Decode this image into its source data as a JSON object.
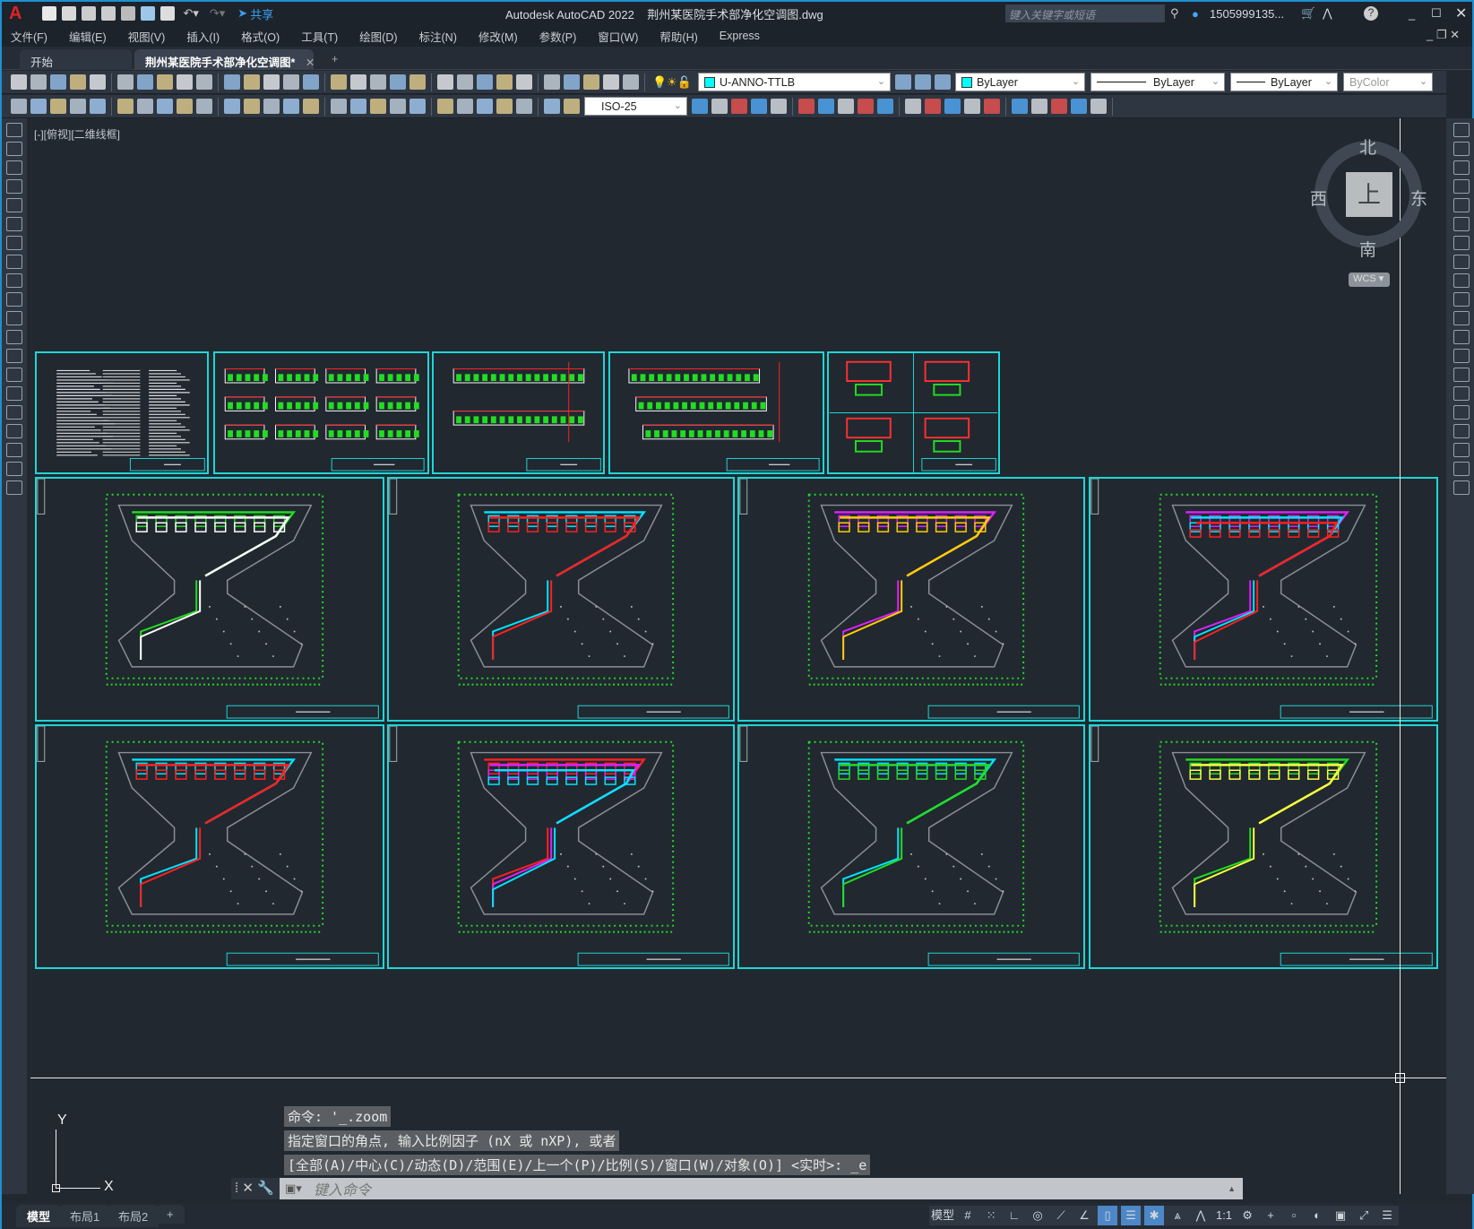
{
  "app": {
    "title": "Autodesk AutoCAD 2022",
    "file": "荆州某医院手术部净化空调图.dwg",
    "share": "共享",
    "search_placeholder": "键入关键字或短语",
    "user": "1505999135...",
    "window_controls": [
      "minimize",
      "maximize",
      "close"
    ]
  },
  "menu": [
    "文件(F)",
    "编辑(E)",
    "视图(V)",
    "插入(I)",
    "格式(O)",
    "工具(T)",
    "绘图(D)",
    "标注(N)",
    "修改(M)",
    "参数(P)",
    "窗口(W)",
    "帮助(H)",
    "Express"
  ],
  "tabs": [
    {
      "label": "开始",
      "active": false
    },
    {
      "label": "荆州某医院手术部净化空调图*",
      "active": true
    }
  ],
  "properties": {
    "layer": "U-ANNO-TTLB",
    "layer_color": "#00ffff",
    "color": "ByLayer",
    "linetype": "ByLayer",
    "lineweight": "ByLayer",
    "plotstyle": "ByColor",
    "dimstyle": "ISO-25"
  },
  "viewport": {
    "label": "[-][俯视][二维线框]"
  },
  "viewcube": {
    "north": "北",
    "south": "南",
    "east": "东",
    "west": "西",
    "face": "上",
    "ucs": "WCS"
  },
  "ucs": {
    "x": "X",
    "y": "Y"
  },
  "command": {
    "history": [
      "命令: '_.zoom",
      "指定窗口的角点, 输入比例因子 (nX 或 nXP), 或者",
      "[全部(A)/中心(C)/动态(D)/范围(E)/上一个(P)/比例(S)/窗口(W)/对象(O)] <实时>: _e"
    ],
    "placeholder": "键入命令"
  },
  "layouts": [
    {
      "label": "模型",
      "active": true
    },
    {
      "label": "布局1",
      "active": false
    },
    {
      "label": "布局2",
      "active": false
    }
  ],
  "status": {
    "model": "模型",
    "scale": "1:1"
  },
  "colors": {
    "frame": "#1ed6d6",
    "grid": "#22dd22",
    "wall": "#8a8f95",
    "duct_cyan": "#00e5ff",
    "duct_red": "#ff2020",
    "duct_magenta": "#e020ff"
  },
  "plans": [
    [
      "#22dd22",
      "#ffffff"
    ],
    [
      "#00e5ff",
      "#ff2020"
    ],
    [
      "#e020ff",
      "#ffd000"
    ],
    [
      "#e020ff",
      "#00e5ff",
      "#ff2020"
    ],
    [
      "#00e5ff",
      "#ff2020"
    ],
    [
      "#ff2020",
      "#e020ff",
      "#00e5ff"
    ],
    [
      "#00e5ff",
      "#22dd22"
    ],
    [
      "#22dd22",
      "#ffff40"
    ]
  ]
}
